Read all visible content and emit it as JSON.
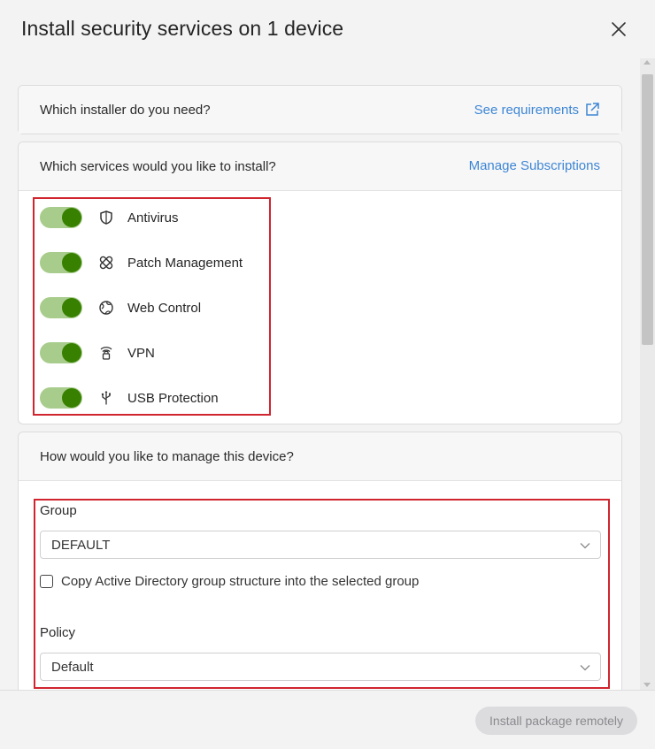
{
  "dialog": {
    "title": "Install security services on 1 device"
  },
  "installer_card": {
    "question": "Which installer do you need?",
    "link_label": "See requirements"
  },
  "services_card": {
    "question": "Which services would you like to install?",
    "link_label": "Manage Subscriptions",
    "services": [
      {
        "label": "Antivirus",
        "icon": "shield-icon",
        "enabled": true
      },
      {
        "label": "Patch Management",
        "icon": "bandage-icon",
        "enabled": true
      },
      {
        "label": "Web Control",
        "icon": "globe-icon",
        "enabled": true
      },
      {
        "label": "VPN",
        "icon": "wifi-lock-icon",
        "enabled": true
      },
      {
        "label": "USB Protection",
        "icon": "usb-icon",
        "enabled": true
      }
    ]
  },
  "management_card": {
    "question": "How would you like to manage this device?",
    "group_label": "Group",
    "group_value": "DEFAULT",
    "copy_ad_label": "Copy Active Directory group structure into the selected group",
    "copy_ad_checked": false,
    "policy_label": "Policy",
    "policy_value": "Default"
  },
  "footer": {
    "install_label": "Install package remotely"
  },
  "colors": {
    "toggle_track": "#a8cc8c",
    "toggle_knob": "#378000",
    "link": "#3d86d4",
    "highlight_frame": "#d0252e"
  }
}
